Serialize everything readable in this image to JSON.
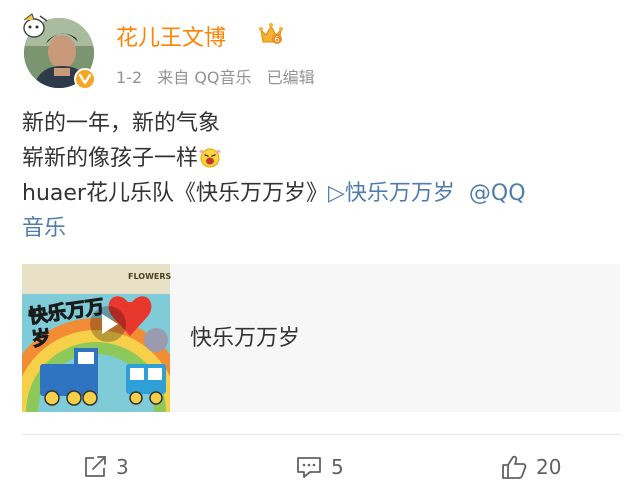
{
  "post": {
    "user": {
      "name": "花儿王文博"
    },
    "meta": {
      "date": "1-2",
      "source": "来自 QQ音乐",
      "edited": "已编辑"
    },
    "content": {
      "line1": "新的一年，新的气象",
      "line2": "崭新的像孩子一样",
      "line3_text": "huaer花儿乐队《快乐万万岁》",
      "line3_link": "▷快乐万万岁",
      "line3_mention_a": "@QQ",
      "line4_mention_b": "音乐"
    },
    "card": {
      "title": "快乐万万岁",
      "cover_text": "快乐万万岁",
      "cover_brand": "FLOWERS"
    },
    "actions": {
      "repost_count": "3",
      "comment_count": "5",
      "like_count": "20"
    }
  },
  "colors": {
    "username": "#ff8200",
    "link": "#507daf",
    "meta": "#939393",
    "action": "#636363"
  }
}
